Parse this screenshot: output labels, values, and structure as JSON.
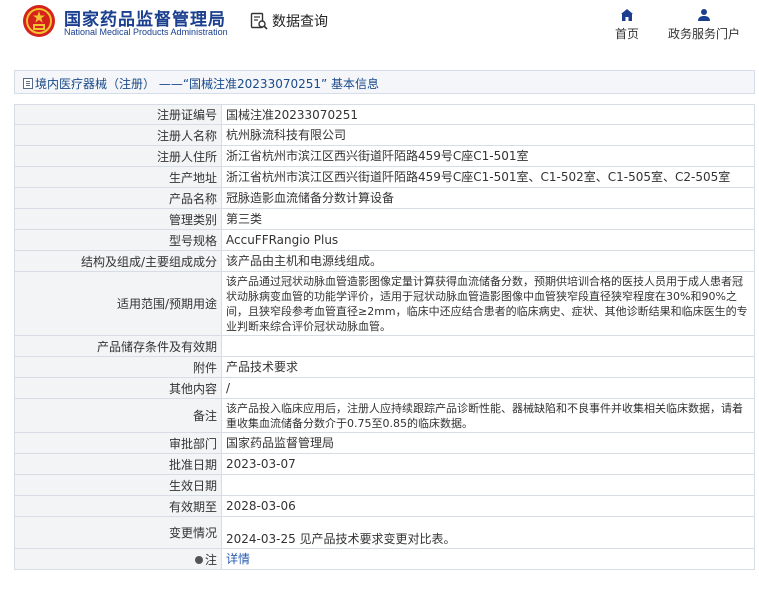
{
  "header": {
    "org_cn": "国家药品监督管理局",
    "org_en": "National Medical Products Administration",
    "query_label": "数据查询",
    "nav": [
      {
        "label": "首页",
        "icon": "home-icon"
      },
      {
        "label": "政务服务门户",
        "icon": "user-icon"
      }
    ]
  },
  "breadcrumb": {
    "text": "境内医疗器械（注册） ——“国械注准20233070251” 基本信息"
  },
  "record": {
    "rows": [
      {
        "label": "注册证编号",
        "value": "国械注准20233070251"
      },
      {
        "label": "注册人名称",
        "value": "杭州脉流科技有限公司"
      },
      {
        "label": "注册人住所",
        "value": "浙江省杭州市滨江区西兴街道阡陌路459号C座C1-501室"
      },
      {
        "label": "生产地址",
        "value": "浙江省杭州市滨江区西兴街道阡陌路459号C座C1-501室、C1-502室、C1-505室、C2-505室"
      },
      {
        "label": "产品名称",
        "value": "冠脉造影血流储备分数计算设备"
      },
      {
        "label": "管理类别",
        "value": "第三类"
      },
      {
        "label": "型号规格",
        "value": "AccuFFRangio Plus"
      },
      {
        "label": "结构及组成/主要组成成分",
        "value": "该产品由主机和电源线组成。"
      },
      {
        "label": "适用范围/预期用途",
        "value": "该产品通过冠状动脉血管造影图像定量计算获得血流储备分数，预期供培训合格的医技人员用于成人患者冠状动脉病变血管的功能学评价，适用于冠状动脉血管造影图像中血管狭窄段直径狭窄程度在30%和90%之间，且狭窄段参考血管直径≥2mm，临床中还应结合患者的临床病史、症状、其他诊断结果和临床医生的专业判断来综合评价冠状动脉血管。"
      },
      {
        "label": "产品储存条件及有效期",
        "value": ""
      },
      {
        "label": "附件",
        "value": "产品技术要求"
      },
      {
        "label": "其他内容",
        "value": "/"
      },
      {
        "label": "备注",
        "value": "该产品投入临床应用后，注册人应持续跟踪产品诊断性能、器械缺陷和不良事件并收集相关临床数据，请着重收集血流储备分数介于0.75至0.85的临床数据。"
      },
      {
        "label": "审批部门",
        "value": "国家药品监督管理局"
      },
      {
        "label": "批准日期",
        "value": "2023-03-07"
      },
      {
        "label": "生效日期",
        "value": ""
      },
      {
        "label": "有效期至",
        "value": "2028-03-06"
      },
      {
        "label": "变更情况",
        "value": "2024-03-25 见产品技术要求变更对比表。"
      },
      {
        "label": "注",
        "value": "详情"
      }
    ]
  },
  "colors": {
    "brand": "#1a3f8f",
    "link": "#2a5db0",
    "label_bg": "#f3f4f6",
    "border": "#d8dde5"
  }
}
